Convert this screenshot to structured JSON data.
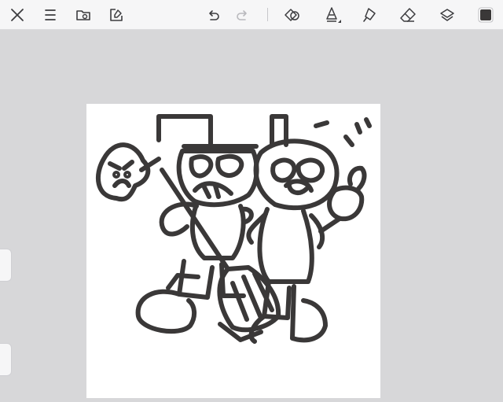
{
  "toolbar": {
    "left_tools": [
      {
        "name": "close-icon",
        "interactable": true
      },
      {
        "name": "menu-icon",
        "interactable": true
      },
      {
        "name": "gallery-folder-icon",
        "interactable": true
      },
      {
        "name": "canvas-actions-icon",
        "interactable": true
      }
    ],
    "history": [
      {
        "name": "undo-icon",
        "enabled": true
      },
      {
        "name": "redo-icon",
        "enabled": false
      }
    ],
    "right_tools": [
      {
        "name": "shapes-icon"
      },
      {
        "name": "pen-tool-icon"
      },
      {
        "name": "fill-bucket-icon"
      },
      {
        "name": "eraser-icon"
      },
      {
        "name": "layers-icon"
      },
      {
        "name": "color-swatch"
      }
    ],
    "current_color": "#3a3838"
  },
  "canvas": {
    "background": "#ffffff",
    "stroke_color": "#3a3838"
  },
  "colors": {
    "toolbar_bg": "#f6f6f7",
    "workspace_bg": "#d7d7d9",
    "icon": "#3c3c3f",
    "icon_disabled": "#b9b9bd"
  }
}
